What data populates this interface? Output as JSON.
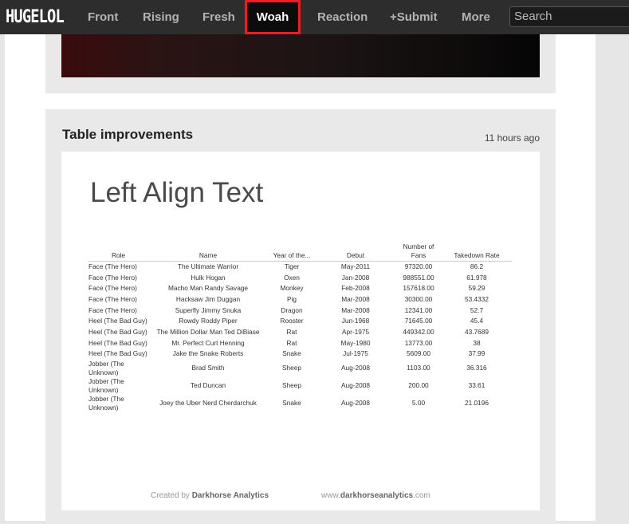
{
  "nav": {
    "logo": "HUGELOL",
    "items": [
      "Front",
      "Rising",
      "Fresh",
      "Woah",
      "Reaction",
      "+Submit",
      "More"
    ],
    "active": "Woah",
    "search_placeholder": "Search",
    "accent": "#ee1c24"
  },
  "post": {
    "title": "Table improvements",
    "time": "11 hours ago"
  },
  "image": {
    "heading": "Left Align Text",
    "columns": [
      "Role",
      "Name",
      "Year of the...",
      "Debut",
      "Number of Fans",
      "Takedown Rate"
    ],
    "rows": [
      [
        "Face (The Hero)",
        "The Ultimate Warrior",
        "Tiger",
        "May-2011",
        "97320.00",
        "86.2"
      ],
      [
        "Face (The Hero)",
        "Hulk Hogan",
        "Oxen",
        "Jan-2008",
        "988551.00",
        "61.978"
      ],
      [
        "Face (The Hero)",
        "Macho Man Randy Savage",
        "Monkey",
        "Feb-2008",
        "157618.00",
        "59.29"
      ],
      [
        "Face (The Hero)",
        "Hacksaw Jim Duggan",
        "Pig",
        "Mar-2008",
        "30300.00",
        "53.4332"
      ],
      [
        "Face (The Hero)",
        "Superfly Jimmy Snuka",
        "Dragon",
        "Mar-2008",
        "12341.00",
        "52.7"
      ],
      [
        "Heel (The Bad Guy)",
        "Rowdy Roddy Piper",
        "Rooster",
        "Jun-1968",
        "71645.00",
        "45.4"
      ],
      [
        "Heel (The Bad Guy)",
        "The Million Dollar Man Ted DiBiase",
        "Rat",
        "Apr-1975",
        "449342.00",
        "43.7689"
      ],
      [
        "Heel (The Bad Guy)",
        "Mr. Perfect Curt Henning",
        "Rat",
        "May-1980",
        "13773.00",
        "38"
      ],
      [
        "Heel (The Bad Guy)",
        "Jake the Snake Roberts",
        "Snake",
        "Jul-1975",
        "5609.00",
        "37.99"
      ],
      [
        "Jobber (The Unknown)",
        "Brad Smith",
        "Sheep",
        "Aug-2008",
        "1103.00",
        "36.316"
      ],
      [
        "Jobber (The Unknown)",
        "Ted Duncan",
        "Sheep",
        "Aug-2008",
        "200.00",
        "33.61"
      ],
      [
        "Jobber (The Unknown)",
        "Joey the Uber Nerd Cherdarchuk",
        "Snake",
        "Aug-2008",
        "5.00",
        "21.0196"
      ]
    ],
    "footer_left_prefix": "Created by",
    "footer_left_brand": "Darkhorse Analytics",
    "footer_right_prefix": "www.",
    "footer_right_brand": "darkhorseanalytics",
    ".com": ".com",
    "footer_right_suffix": ".com"
  }
}
